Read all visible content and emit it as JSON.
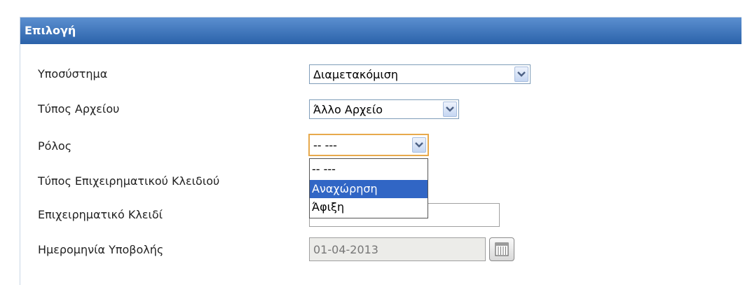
{
  "panel": {
    "title": "Επιλογή"
  },
  "fields": {
    "subsystem": {
      "label": "Υποσύστημα",
      "value": "Διαμετακόμιση"
    },
    "file_type": {
      "label": "Τύπος Αρχείου",
      "value": "Άλλο Αρχείο"
    },
    "role": {
      "label": "Ρόλος",
      "value": "-- ---"
    },
    "business_key_type": {
      "label": "Τύπος Επιχειρηματικού Κλειδιού"
    },
    "business_key": {
      "label": "Επιχειρηματικό Κλειδί",
      "value": ""
    },
    "submission_date": {
      "label": "Ημερομηνία Υποβολής",
      "value": "01-04-2013"
    }
  },
  "role_dropdown": {
    "options": [
      "-- ---",
      "Αναχώρηση",
      "Άφιξη"
    ],
    "highlighted": "Αναχώρηση"
  },
  "icons": {
    "dropdown": "chevron-down-icon",
    "calendar": "calendar-icon"
  },
  "colors": {
    "header": "#2b62aa",
    "highlight": "#3166c5",
    "focus_border": "#e7a94c"
  }
}
